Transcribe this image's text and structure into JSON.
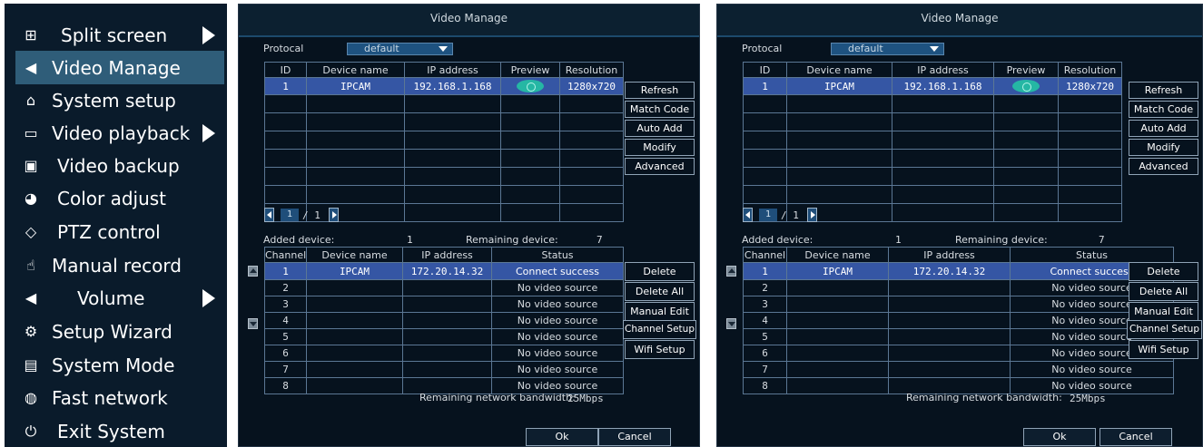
{
  "menu": {
    "items": [
      {
        "label": "Split screen",
        "icon": "grid-icon",
        "arrow": true
      },
      {
        "label": "Video Manage",
        "icon": "camera-icon",
        "active": true
      },
      {
        "label": "System setup",
        "icon": "home-icon"
      },
      {
        "label": "Video playback",
        "icon": "film-icon",
        "arrow": true
      },
      {
        "label": "Video backup",
        "icon": "floppy-icon"
      },
      {
        "label": "Color adjust",
        "icon": "palette-icon"
      },
      {
        "label": "PTZ control",
        "icon": "diamond-icon"
      },
      {
        "label": "Manual record",
        "icon": "hand-icon"
      },
      {
        "label": "Volume",
        "icon": "speaker-icon",
        "arrow": true
      },
      {
        "label": "Setup Wizard",
        "icon": "gears-icon"
      },
      {
        "label": "System Mode",
        "icon": "document-gear-icon"
      },
      {
        "label": "Fast network",
        "icon": "globe-icon"
      },
      {
        "label": "Exit System",
        "icon": "power-icon"
      }
    ]
  },
  "dialog": {
    "title": "Video Manage",
    "protocol_label": "Protocal",
    "protocol_value": "default",
    "search_table": {
      "headers": [
        "ID",
        "Device name",
        "IP address",
        "Preview",
        "Resolution"
      ],
      "rows": [
        {
          "id": "1",
          "name": "IPCAM",
          "ip": "192.168.1.168",
          "resolution": "1280x720"
        }
      ]
    },
    "page": {
      "current": "1",
      "total": "/ 1"
    },
    "side_buttons": [
      "Refresh",
      "Match Code",
      "Auto Add",
      "Modify",
      "Advanced"
    ],
    "added_label": "Added device:",
    "added_value": "1",
    "remaining_label": "Remaining device:",
    "remaining_value": "7",
    "channel_table": {
      "headers": [
        "Channel",
        "Device name",
        "IP address",
        "Status"
      ],
      "rows": [
        {
          "channel": "1",
          "name": "IPCAM",
          "ip": "172.20.14.32",
          "status": "Connect success"
        },
        {
          "channel": "2",
          "name": "",
          "ip": "",
          "status": "No video source"
        },
        {
          "channel": "3",
          "name": "",
          "ip": "",
          "status": "No video source"
        },
        {
          "channel": "4",
          "name": "",
          "ip": "",
          "status": "No video source"
        },
        {
          "channel": "5",
          "name": "",
          "ip": "",
          "status": "No video source"
        },
        {
          "channel": "6",
          "name": "",
          "ip": "",
          "status": "No video source"
        },
        {
          "channel": "7",
          "name": "",
          "ip": "",
          "status": "No video source"
        },
        {
          "channel": "8",
          "name": "",
          "ip": "",
          "status": "No video source"
        }
      ]
    },
    "channel_buttons": [
      "Delete",
      "Delete All",
      "Manual Edit",
      "Channel Setup",
      "Wifi Setup"
    ],
    "bandwidth_label": "Remaining network bandwidth:",
    "bandwidth_value": "25Mbps",
    "ok_label": "Ok",
    "cancel_label": "Cancel"
  },
  "colors": {
    "menu_bg": "#0a1b2b",
    "menu_active": "#2f5d79",
    "dialog_bg": "#06121e",
    "row_highlight": "#3556a4",
    "grid_line": "#5b7794",
    "preview_icon": "#25b7a4"
  }
}
